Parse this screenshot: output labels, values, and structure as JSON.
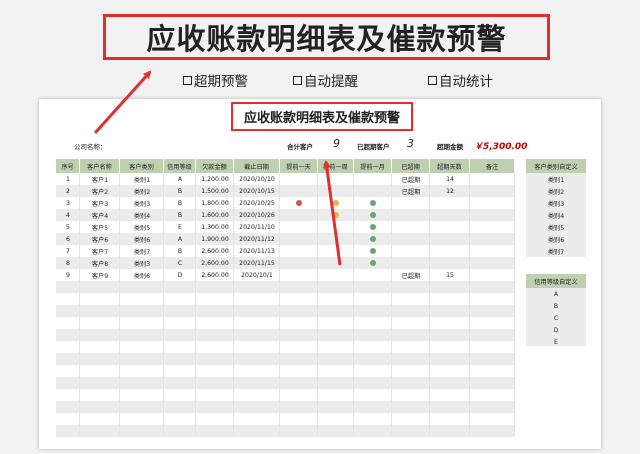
{
  "banner": {
    "title": "应收账款明细表及催款预警"
  },
  "features": [
    {
      "label": "超期预警"
    },
    {
      "label": "自动提醒"
    },
    {
      "label": "自动统计"
    }
  ],
  "sheet": {
    "title": "应收账款明细表及催款预警",
    "company_label": "公司名称：",
    "total_customers_label": "合计客户",
    "total_customers_value": "9",
    "overdue_customers_label": "已超期客户",
    "overdue_customers_value": "3",
    "overdue_amount_label": "超期金额",
    "overdue_amount_value": "￥5,300.00"
  },
  "table": {
    "headers": [
      "序号",
      "客户名称",
      "客户类别",
      "信用等级",
      "欠款金额",
      "截止日期",
      "提前一天",
      "提前一周",
      "提前一月",
      "已超期",
      "超期天数",
      "备注"
    ],
    "rows": [
      {
        "no": "1",
        "name": "客户1",
        "type": "类别1",
        "level": "A",
        "amount": "1,200.00",
        "date": "2020/10/10",
        "d1": "",
        "w1": "",
        "m1": "",
        "overdue": "已超期",
        "days": "14",
        "note": ""
      },
      {
        "no": "2",
        "name": "客户2",
        "type": "类别2",
        "level": "B",
        "amount": "1,500.00",
        "date": "2020/10/15",
        "d1": "",
        "w1": "",
        "m1": "",
        "overdue": "已超期",
        "days": "12",
        "note": ""
      },
      {
        "no": "3",
        "name": "客户3",
        "type": "类别3",
        "level": "B",
        "amount": "1,800.00",
        "date": "2020/10/25",
        "d1": "red",
        "w1": "orange",
        "m1": "green",
        "overdue": "",
        "days": "",
        "note": ""
      },
      {
        "no": "4",
        "name": "客户4",
        "type": "类别4",
        "level": "B",
        "amount": "1,600.00",
        "date": "2020/10/26",
        "d1": "",
        "w1": "orange",
        "m1": "green",
        "overdue": "",
        "days": "",
        "note": ""
      },
      {
        "no": "5",
        "name": "客户5",
        "type": "类别5",
        "level": "E",
        "amount": "1,300.00",
        "date": "2020/11/10",
        "d1": "",
        "w1": "",
        "m1": "green",
        "overdue": "",
        "days": "",
        "note": ""
      },
      {
        "no": "6",
        "name": "客户6",
        "type": "类别6",
        "level": "A",
        "amount": "1,900.00",
        "date": "2020/11/12",
        "d1": "",
        "w1": "",
        "m1": "green",
        "overdue": "",
        "days": "",
        "note": ""
      },
      {
        "no": "7",
        "name": "客户7",
        "type": "类别7",
        "level": "B",
        "amount": "2,600.00",
        "date": "2020/11/13",
        "d1": "",
        "w1": "",
        "m1": "green",
        "overdue": "",
        "days": "",
        "note": ""
      },
      {
        "no": "8",
        "name": "客户8",
        "type": "类别3",
        "level": "C",
        "amount": "2,600.00",
        "date": "2020/11/15",
        "d1": "",
        "w1": "",
        "m1": "green",
        "overdue": "",
        "days": "",
        "note": ""
      },
      {
        "no": "9",
        "name": "客户9",
        "type": "类别6",
        "level": "D",
        "amount": "2,600.00",
        "date": "2020/10/1",
        "d1": "",
        "w1": "",
        "m1": "",
        "overdue": "已超期",
        "days": "15",
        "note": ""
      }
    ]
  },
  "category_panel": {
    "header": "客户类别自定义",
    "items": [
      "类别1",
      "类别2",
      "类别3",
      "类别4",
      "类别5",
      "类别6",
      "类别7"
    ]
  },
  "credit_panel": {
    "header": "信用等级自定义",
    "items": [
      "A",
      "B",
      "C",
      "D",
      "E"
    ]
  },
  "colors": {
    "red": "#d9534f",
    "orange": "#f0ad4e",
    "green": "#6aa57a",
    "header": "#bfcfb2",
    "accent": "#e02f2f"
  }
}
